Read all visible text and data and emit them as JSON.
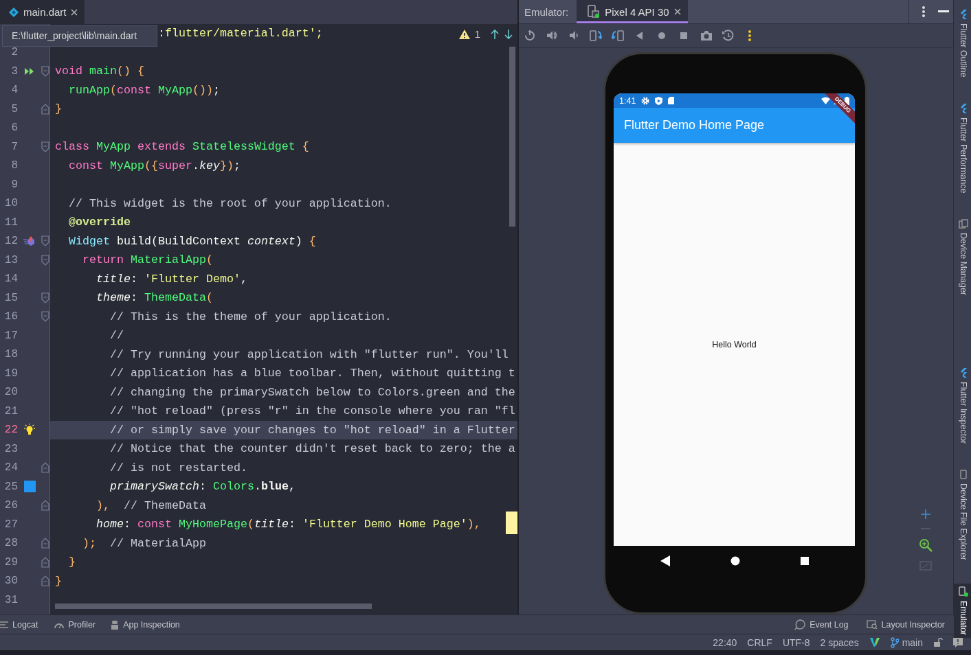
{
  "editor": {
    "tabs": [
      {
        "label": "main.dart",
        "selected": true
      }
    ],
    "tooltip": "E:\\flutter_project\\lib\\main.dart",
    "warning_count": "1",
    "lines": [
      {
        "current": false,
        "tokens": [
          {
            "t": ":flutter/material.dart';",
            "kind": "str"
          }
        ]
      },
      {
        "number": "2",
        "current": false
      },
      {
        "number": "3",
        "current": false,
        "gutter": {
          "kind": "run"
        },
        "fold": {
          "kind": "start"
        },
        "tokens": [
          {
            "t": "void",
            "kind": "kw"
          },
          {
            "t": " main",
            "kind": "fn"
          },
          {
            "t": "() {",
            "kind": "paren"
          }
        ]
      },
      {
        "number": "4",
        "current": false,
        "tokens": [
          {
            "t": "  runApp",
            "kind": "fn"
          },
          {
            "t": "(",
            "kind": "paren"
          },
          {
            "t": "const",
            "kind": "kw"
          },
          {
            "t": " MyApp",
            "kind": "fn"
          },
          {
            "t": "())",
            "kind": "paren"
          },
          {
            "t": ";",
            "kind": "plain"
          }
        ]
      },
      {
        "number": "5",
        "current": false,
        "fold": {
          "kind": "end"
        },
        "tokens": [
          {
            "t": "}",
            "kind": "paren"
          }
        ]
      },
      {
        "number": "6",
        "current": false
      },
      {
        "number": "7",
        "current": false,
        "fold": {
          "kind": "start"
        },
        "tokens": [
          {
            "t": "class",
            "kind": "kw"
          },
          {
            "t": " MyApp ",
            "kind": "fn"
          },
          {
            "t": "extends",
            "kind": "kw"
          },
          {
            "t": " StatelessWidget ",
            "kind": "fn"
          },
          {
            "t": "{",
            "kind": "paren"
          }
        ]
      },
      {
        "number": "8",
        "current": false,
        "tokens": [
          {
            "t": "  const",
            "kind": "kw"
          },
          {
            "t": " MyApp",
            "kind": "fn"
          },
          {
            "t": "({",
            "kind": "paren"
          },
          {
            "t": "super",
            "kind": "kw"
          },
          {
            "t": ".",
            "kind": "plain"
          },
          {
            "t": "key",
            "kind": "param"
          },
          {
            "t": "})",
            "kind": "paren"
          },
          {
            "t": ";",
            "kind": "plain"
          }
        ]
      },
      {
        "number": "9",
        "current": false
      },
      {
        "number": "10",
        "current": false,
        "tokens": [
          {
            "t": "  // This widget is the root of your application.",
            "kind": "com"
          }
        ]
      },
      {
        "number": "11",
        "current": false,
        "tokens": [
          {
            "t": "  @override",
            "kind": "ann"
          }
        ]
      },
      {
        "number": "12",
        "current": false,
        "gutter": {
          "kind": "override"
        },
        "fold": {
          "kind": "start"
        },
        "tokens": [
          {
            "t": "  Widget",
            "kind": "type"
          },
          {
            "t": " build(BuildContext ",
            "kind": "plain"
          },
          {
            "t": "context",
            "kind": "param"
          },
          {
            "t": ") ",
            "kind": "plain"
          },
          {
            "t": "{",
            "kind": "paren"
          }
        ]
      },
      {
        "number": "13",
        "current": false,
        "fold": {
          "kind": "start"
        },
        "tokens": [
          {
            "t": "    return",
            "kind": "kw"
          },
          {
            "t": " MaterialApp",
            "kind": "fn"
          },
          {
            "t": "(",
            "kind": "paren"
          }
        ]
      },
      {
        "number": "14",
        "current": false,
        "tokens": [
          {
            "t": "      title",
            "kind": "param"
          },
          {
            "t": ": ",
            "kind": "plain"
          },
          {
            "t": "'Flutter Demo'",
            "kind": "str"
          },
          {
            "t": ",",
            "kind": "plain"
          }
        ]
      },
      {
        "number": "15",
        "current": false,
        "fold": {
          "kind": "start"
        },
        "tokens": [
          {
            "t": "      theme",
            "kind": "param"
          },
          {
            "t": ": ",
            "kind": "plain"
          },
          {
            "t": "ThemeData",
            "kind": "fn"
          },
          {
            "t": "(",
            "kind": "paren"
          }
        ]
      },
      {
        "number": "16",
        "current": false,
        "fold": {
          "kind": "start"
        },
        "tokens": [
          {
            "t": "        // This is the theme of your application.",
            "kind": "com"
          }
        ]
      },
      {
        "number": "17",
        "current": false,
        "tokens": [
          {
            "t": "        //",
            "kind": "com"
          }
        ]
      },
      {
        "number": "18",
        "current": false,
        "tokens": [
          {
            "t": "        // Try running your application with \"flutter run\". You'll",
            "kind": "com"
          }
        ]
      },
      {
        "number": "19",
        "current": false,
        "tokens": [
          {
            "t": "        // application has a blue toolbar. Then, without quitting t",
            "kind": "com"
          }
        ]
      },
      {
        "number": "20",
        "current": false,
        "tokens": [
          {
            "t": "        // changing the primarySwatch below to Colors.green and the",
            "kind": "com"
          }
        ]
      },
      {
        "number": "21",
        "current": false,
        "tokens": [
          {
            "t": "        // \"hot reload\" (press \"r\" in the console where you ran \"fl",
            "kind": "com"
          }
        ]
      },
      {
        "number": "22",
        "current": true,
        "gutter": {
          "kind": "bulb"
        },
        "tokens": [
          {
            "t": "        // or simply save your changes to \"hot reload\" in a Flutter",
            "kind": "com"
          }
        ]
      },
      {
        "number": "23",
        "current": false,
        "tokens": [
          {
            "t": "        // Notice that the counter didn't reset back to zero; the a",
            "kind": "com"
          }
        ]
      },
      {
        "number": "24",
        "current": false,
        "fold": {
          "kind": "end"
        },
        "tokens": [
          {
            "t": "        // is not restarted.",
            "kind": "com"
          }
        ]
      },
      {
        "number": "25",
        "current": false,
        "gutter": {
          "kind": "color",
          "color": "#2196f3"
        },
        "tokens": [
          {
            "t": "        primarySwatch",
            "kind": "param"
          },
          {
            "t": ": ",
            "kind": "plain"
          },
          {
            "t": "Colors",
            "kind": "fn"
          },
          {
            "t": ".",
            "kind": "plain"
          },
          {
            "t": "blue",
            "kind": "bold"
          },
          {
            "t": ",",
            "kind": "plain"
          }
        ]
      },
      {
        "number": "26",
        "current": false,
        "fold": {
          "kind": "end"
        },
        "tokens": [
          {
            "t": "      ),",
            "kind": "paren"
          },
          {
            "t": "  // ThemeData",
            "kind": "com"
          }
        ]
      },
      {
        "number": "27",
        "current": false,
        "tokens": [
          {
            "t": "      home",
            "kind": "param"
          },
          {
            "t": ": ",
            "kind": "plain"
          },
          {
            "t": "const",
            "kind": "kw"
          },
          {
            "t": " MyHomePage",
            "kind": "fn"
          },
          {
            "t": "(",
            "kind": "paren"
          },
          {
            "t": "title",
            "kind": "param"
          },
          {
            "t": ": ",
            "kind": "plain"
          },
          {
            "t": "'Flutter Demo Home Page'",
            "kind": "str"
          },
          {
            "t": "),",
            "kind": "paren"
          }
        ]
      },
      {
        "number": "28",
        "current": false,
        "fold": {
          "kind": "end"
        },
        "tokens": [
          {
            "t": "    );",
            "kind": "paren"
          },
          {
            "t": "  // MaterialApp",
            "kind": "com"
          }
        ]
      },
      {
        "number": "29",
        "current": false,
        "fold": {
          "kind": "end"
        },
        "tokens": [
          {
            "t": "  }",
            "kind": "paren"
          }
        ]
      },
      {
        "number": "30",
        "current": false,
        "fold": {
          "kind": "end"
        },
        "tokens": [
          {
            "t": "}",
            "kind": "paren"
          }
        ]
      },
      {
        "number": "31",
        "current": false
      }
    ]
  },
  "emulator": {
    "label": "Emulator:",
    "tabs": [
      {
        "label": "Pixel 4 API 30",
        "selected": true
      }
    ],
    "device": {
      "status_time": "1:41",
      "app_title": "Flutter Demo Home Page",
      "body_text": "Hello World",
      "banner": "DEBUG"
    }
  },
  "right_sidebar": {
    "items": [
      {
        "label": "Flutter Outline",
        "kind": "flutter",
        "selected": false
      },
      {
        "label": "Flutter Performance",
        "kind": "flutter",
        "selected": false
      },
      {
        "label": "Device Manager",
        "kind": "devices",
        "selected": false
      },
      {
        "label": "Flutter Inspector",
        "kind": "flutter",
        "selected": false
      },
      {
        "label": "Device File Explorer",
        "kind": "phone",
        "selected": false
      },
      {
        "label": "Emulator",
        "kind": "emulator",
        "selected": true
      }
    ]
  },
  "bottom_tools": {
    "left": [
      {
        "label": "Logcat",
        "kind": "logcat"
      },
      {
        "label": "Profiler",
        "kind": "profiler"
      },
      {
        "label": "App Inspection",
        "kind": "inspection"
      }
    ],
    "right": [
      {
        "label": "Event Log",
        "kind": "eventlog"
      },
      {
        "label": "Layout Inspector",
        "kind": "layout"
      }
    ]
  },
  "status_bar": {
    "items": [
      "22:40",
      "CRLF",
      "UTF-8",
      "2 spaces"
    ],
    "branch": "main"
  }
}
